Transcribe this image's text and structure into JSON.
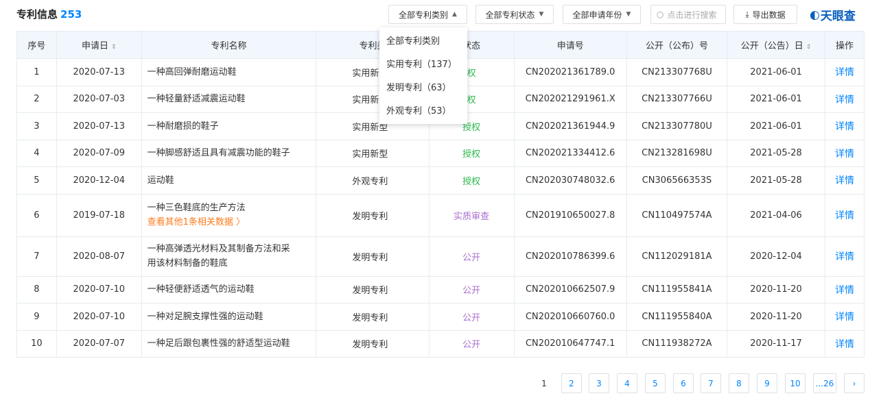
{
  "header": {
    "title": "专利信息",
    "count": "253",
    "filter_type": "全部专利类别",
    "filter_status": "全部专利状态",
    "filter_year": "全部申请年份",
    "search_placeholder": "点击进行搜索",
    "export_label": "导出数据",
    "logo_text": "天眼查"
  },
  "columns": {
    "index": "序号",
    "apply_date": "申请日",
    "name": "专利名称",
    "type": "专利类",
    "status": "状态",
    "apply_no": "申请号",
    "pub_no": "公开（公布）号",
    "pub_date": "公开（公告）日",
    "action": "操作"
  },
  "dropdown": {
    "items": [
      "全部专利类别",
      "实用专利（137）",
      "发明专利（63）",
      "外观专利（53）"
    ]
  },
  "rows": [
    {
      "index": "1",
      "apply_date": "2020-07-13",
      "name": "一种高回弹耐磨运动鞋",
      "type": "实用新",
      "status": "权",
      "apply_no": "CN202021361789.0",
      "pub_no": "CN213307768U",
      "pub_date": "2021-06-01",
      "action": "详情"
    },
    {
      "index": "2",
      "apply_date": "2020-07-03",
      "name": "一种轻量舒适减震运动鞋",
      "type": "实用新",
      "status": "权",
      "apply_no": "CN202021291961.X",
      "pub_no": "CN213307766U",
      "pub_date": "2021-06-01",
      "action": "详情"
    },
    {
      "index": "3",
      "apply_date": "2020-07-13",
      "name": "一种耐磨损的鞋子",
      "type": "实用新型",
      "status": "授权",
      "apply_no": "CN202021361944.9",
      "pub_no": "CN213307780U",
      "pub_date": "2021-06-01",
      "action": "详情"
    },
    {
      "index": "4",
      "apply_date": "2020-07-09",
      "name": "一种脚感舒适且具有减震功能的鞋子",
      "type": "实用新型",
      "status": "授权",
      "apply_no": "CN202021334412.6",
      "pub_no": "CN213281698U",
      "pub_date": "2021-05-28",
      "action": "详情"
    },
    {
      "index": "5",
      "apply_date": "2020-12-04",
      "name": "运动鞋",
      "type": "外观专利",
      "status": "授权",
      "apply_no": "CN202030748032.6",
      "pub_no": "CN306566353S",
      "pub_date": "2021-05-28",
      "action": "详情"
    },
    {
      "index": "6",
      "apply_date": "2019-07-18",
      "name": "一种三色鞋底的生产方法",
      "more": "查看其他1条相关数据 〉",
      "type": "发明专利",
      "status": "实质审查",
      "apply_no": "CN201910650027.8",
      "pub_no": "CN110497574A",
      "pub_date": "2021-04-06",
      "action": "详情"
    },
    {
      "index": "7",
      "apply_date": "2020-08-07",
      "name": "一种高弹透光材料及其制备方法和采",
      "name2": "用该材料制备的鞋底",
      "type": "发明专利",
      "status": "公开",
      "apply_no": "CN202010786399.6",
      "pub_no": "CN112029181A",
      "pub_date": "2020-12-04",
      "action": "详情"
    },
    {
      "index": "8",
      "apply_date": "2020-07-10",
      "name": "一种轻便舒适透气的运动鞋",
      "type": "发明专利",
      "status": "公开",
      "apply_no": "CN202010662507.9",
      "pub_no": "CN111955841A",
      "pub_date": "2020-11-20",
      "action": "详情"
    },
    {
      "index": "9",
      "apply_date": "2020-07-10",
      "name": "一种对足腕支撑性强的运动鞋",
      "type": "发明专利",
      "status": "公开",
      "apply_no": "CN202010660760.0",
      "pub_no": "CN111955840A",
      "pub_date": "2020-11-20",
      "action": "详情"
    },
    {
      "index": "10",
      "apply_date": "2020-07-07",
      "name": "一种足后跟包裹性强的舒适型运动鞋",
      "type": "发明专利",
      "status": "公开",
      "apply_no": "CN202010647747.1",
      "pub_no": "CN111938272A",
      "pub_date": "2020-11-17",
      "action": "详情"
    }
  ],
  "pager": {
    "pages": [
      "1",
      "2",
      "3",
      "4",
      "5",
      "6",
      "7",
      "8",
      "9",
      "10",
      "...26"
    ],
    "next": "›"
  },
  "colors": {
    "accent": "#0084ff",
    "status_granted": "#2db84d",
    "status_review": "#a96ecf",
    "header_bg": "#f1f7fd",
    "more_link": "#ff7a1a"
  }
}
